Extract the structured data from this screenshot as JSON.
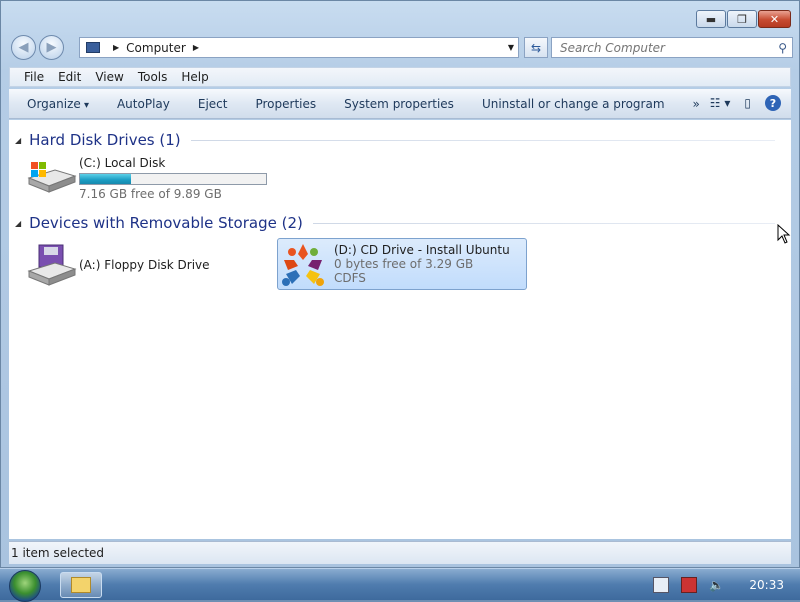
{
  "window": {
    "caption_buttons": {
      "minimize": "▬",
      "maximize": "❐",
      "close": "✕"
    }
  },
  "nav": {
    "back_icon": "back-arrow-icon",
    "forward_icon": "forward-arrow-icon",
    "address_path": "Computer",
    "search_placeholder": "Search Computer"
  },
  "menu": {
    "items": [
      "File",
      "Edit",
      "View",
      "Tools",
      "Help"
    ]
  },
  "toolbar": {
    "organize": "Organize",
    "autoplay": "AutoPlay",
    "eject": "Eject",
    "properties": "Properties",
    "system_properties": "System properties",
    "uninstall": "Uninstall or change a program",
    "more": "»"
  },
  "groups": {
    "hard_disks": {
      "title": "Hard Disk Drives (1)",
      "items": [
        {
          "label": "(C:) Local Disk",
          "detail": "7.16 GB free of 9.89 GB",
          "used_fraction": 0.276
        }
      ]
    },
    "removable": {
      "title": "Devices with Removable Storage (2)",
      "items": [
        {
          "label": "(A:) Floppy Disk Drive"
        },
        {
          "label": "(D:) CD Drive - Install Ubuntu",
          "detail": "0 bytes free of 3.29 GB",
          "fs": "CDFS",
          "selected": true
        }
      ]
    }
  },
  "status": {
    "text": "1 item selected"
  },
  "taskbar": {
    "clock": "20:33"
  },
  "colors": {
    "accent": "#1b9cc3",
    "group_header": "#1e3287",
    "selection": "#c1dcfc"
  }
}
